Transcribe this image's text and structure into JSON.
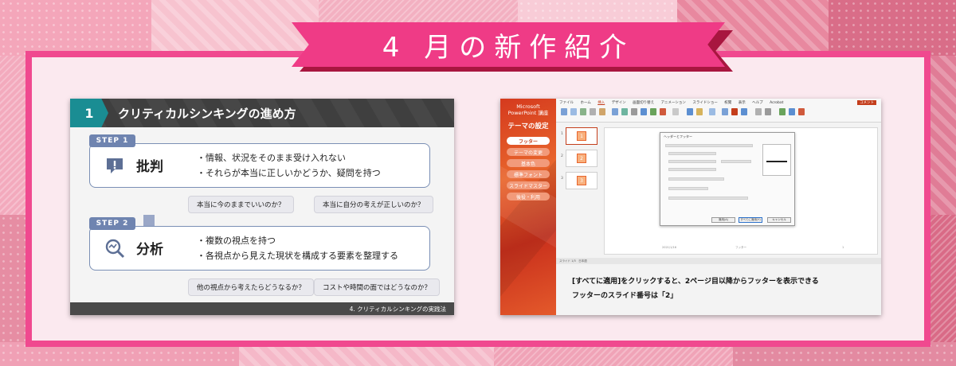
{
  "banner": {
    "title": "4 月の新作紹介"
  },
  "left_slide": {
    "number": "1",
    "title": "クリティカルシンキングの進め方",
    "steps": [
      {
        "tag": "STEP 1",
        "name": "批判",
        "icon": "comment-exclamation-icon",
        "points": [
          "・情報、状況をそのまま受け入れない",
          "・それらが本当に正しいかどうか、疑問を持つ"
        ],
        "questions": [
          "本当に今のままでいいのか？",
          "本当に自分の考えが正しいのか？"
        ]
      },
      {
        "tag": "STEP 2",
        "name": "分析",
        "icon": "magnifier-icon",
        "points": [
          "・複数の視点を持つ",
          "・各視点から見えた現状を構成する要素を整理する"
        ],
        "questions": [
          "他の視点から考えたらどうなるか？",
          "コストや時間の面ではどうなのか？"
        ]
      }
    ],
    "footer": "4. クリティカルシンキングの実践法"
  },
  "right_slide": {
    "brand": [
      "Microsoft",
      "PowerPoint 講座"
    ],
    "section": "テーマの設定",
    "menu": [
      "フッター",
      "テーマの変更",
      "基本色",
      "標準フォント",
      "スライドマスター",
      "後役・利用"
    ],
    "menu_active_index": 0,
    "ribbon_tabs": [
      "ファイル",
      "ホーム",
      "挿入",
      "デザイン",
      "画面切り替え",
      "アニメーション",
      "スライドショー",
      "校閲",
      "表示",
      "ヘルプ",
      "Acrobat"
    ],
    "ribbon_active_index": 2,
    "comment_button": "コメント",
    "thumbnails": [
      "1",
      "2",
      "3"
    ],
    "dialog": {
      "title": "ヘッダーとフッター",
      "buttons": [
        "適用(A)",
        "すべてに適用(Y)",
        "キャンセル"
      ]
    },
    "canvas_footer": [
      "2021/1/16",
      "フッター",
      "1"
    ],
    "status": "スライド 1/3　日本語",
    "captions": [
      "[すべてに適用]をクリックすると、2ページ目以降からフッターを表示できる",
      "フッターのスライド番号は「2」"
    ]
  },
  "colors": {
    "frame_border": "#f0498f",
    "banner": "#ef3b86",
    "banner_shadow": "#a8163f",
    "step_accent": "#6f84b0",
    "number_tab": "#1a8d93",
    "pp_orange": "#e8652c"
  }
}
